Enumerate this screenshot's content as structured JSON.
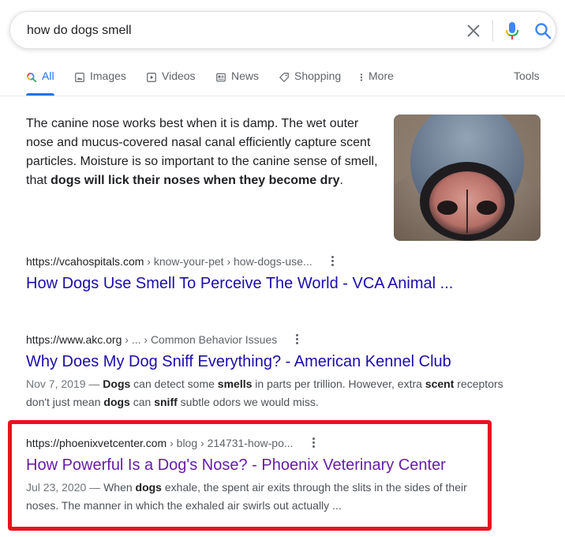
{
  "search": {
    "query": "how do dogs smell"
  },
  "tabs": [
    {
      "label": "All",
      "icon": "search-icon",
      "active": true
    },
    {
      "label": "Images",
      "icon": "image-icon"
    },
    {
      "label": "Videos",
      "icon": "video-icon"
    },
    {
      "label": "News",
      "icon": "news-icon"
    },
    {
      "label": "Shopping",
      "icon": "tag-icon"
    },
    {
      "label": "More",
      "icon": "more-vert-icon"
    }
  ],
  "tools_label": "Tools",
  "snippet": {
    "text_1": "The canine nose works best when it is damp. The wet outer nose and mucus-covered nasal canal efficiently capture scent particles. Moisture is so important to the canine sense of smell, that ",
    "text_bold": "dogs will lick their noses when they become dry",
    "text_end": "."
  },
  "results": [
    {
      "domain": "https://vcahospitals.com",
      "path": " › know-your-pet › how-dogs-use...",
      "title": "How Dogs Use Smell To Perceive The World - VCA Animal ..."
    },
    {
      "domain": "https://www.akc.org",
      "path": " › ... › Common Behavior Issues",
      "title": "Why Does My Dog Sniff Everything? - American Kennel Club",
      "date": "Nov 7, 2019 — ",
      "desc_parts": [
        "",
        "Dogs",
        " can detect some ",
        "smells",
        " in parts per trillion. However, extra ",
        "scent",
        " receptors don't just mean ",
        "dogs",
        " can ",
        "sniff",
        " subtle odors we would miss."
      ]
    },
    {
      "domain": "https://phoenixvetcenter.com",
      "path": " › blog › 214731-how-po...",
      "title": "How Powerful Is a Dog's Nose? - Phoenix Veterinary Center",
      "date": "Jul 23, 2020 — ",
      "desc_parts": [
        "When ",
        "dogs",
        " exhale, the spent air exits through the slits in the sides of their noses. The manner in which the exhaled air swirls out actually ..."
      ]
    }
  ],
  "colors": {
    "link": "#1a0dab",
    "visited": "#681da8",
    "accent": "#1a73e8",
    "highlight": "#e8121e"
  }
}
